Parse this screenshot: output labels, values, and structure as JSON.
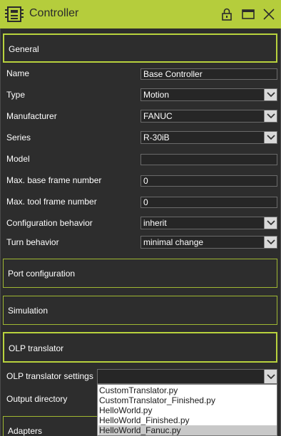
{
  "window": {
    "title": "Controller"
  },
  "sections": {
    "general": "General",
    "port_configuration": "Port configuration",
    "simulation": "Simulation",
    "olp_translator": "OLP translator",
    "adapters": "Adapters"
  },
  "properties": {
    "name": {
      "label": "Name",
      "value": "Base Controller"
    },
    "type": {
      "label": "Type",
      "value": "Motion"
    },
    "manufacturer": {
      "label": "Manufacturer",
      "value": "FANUC"
    },
    "series": {
      "label": "Series",
      "value": "R-30iB"
    },
    "model": {
      "label": "Model",
      "value": ""
    },
    "max_base_frame": {
      "label": "Max. base frame number",
      "value": "0"
    },
    "max_tool_frame": {
      "label": "Max. tool frame number",
      "value": "0"
    },
    "config_behavior": {
      "label": "Configuration behavior",
      "value": "inherit"
    },
    "turn_behavior": {
      "label": "Turn behavior",
      "value": "minimal change"
    }
  },
  "olp": {
    "settings_label": "OLP translator settings",
    "output_dir_label": "Output directory",
    "options": [
      "CustomTranslator.py",
      "CustomTranslator_Finished.py",
      "HelloWorld.py",
      "HelloWorld_Finished.py",
      "HelloWorld_Fanuc.py"
    ]
  },
  "colors": {
    "accent": "#b5cd3c",
    "background": "#2d2d2d"
  }
}
